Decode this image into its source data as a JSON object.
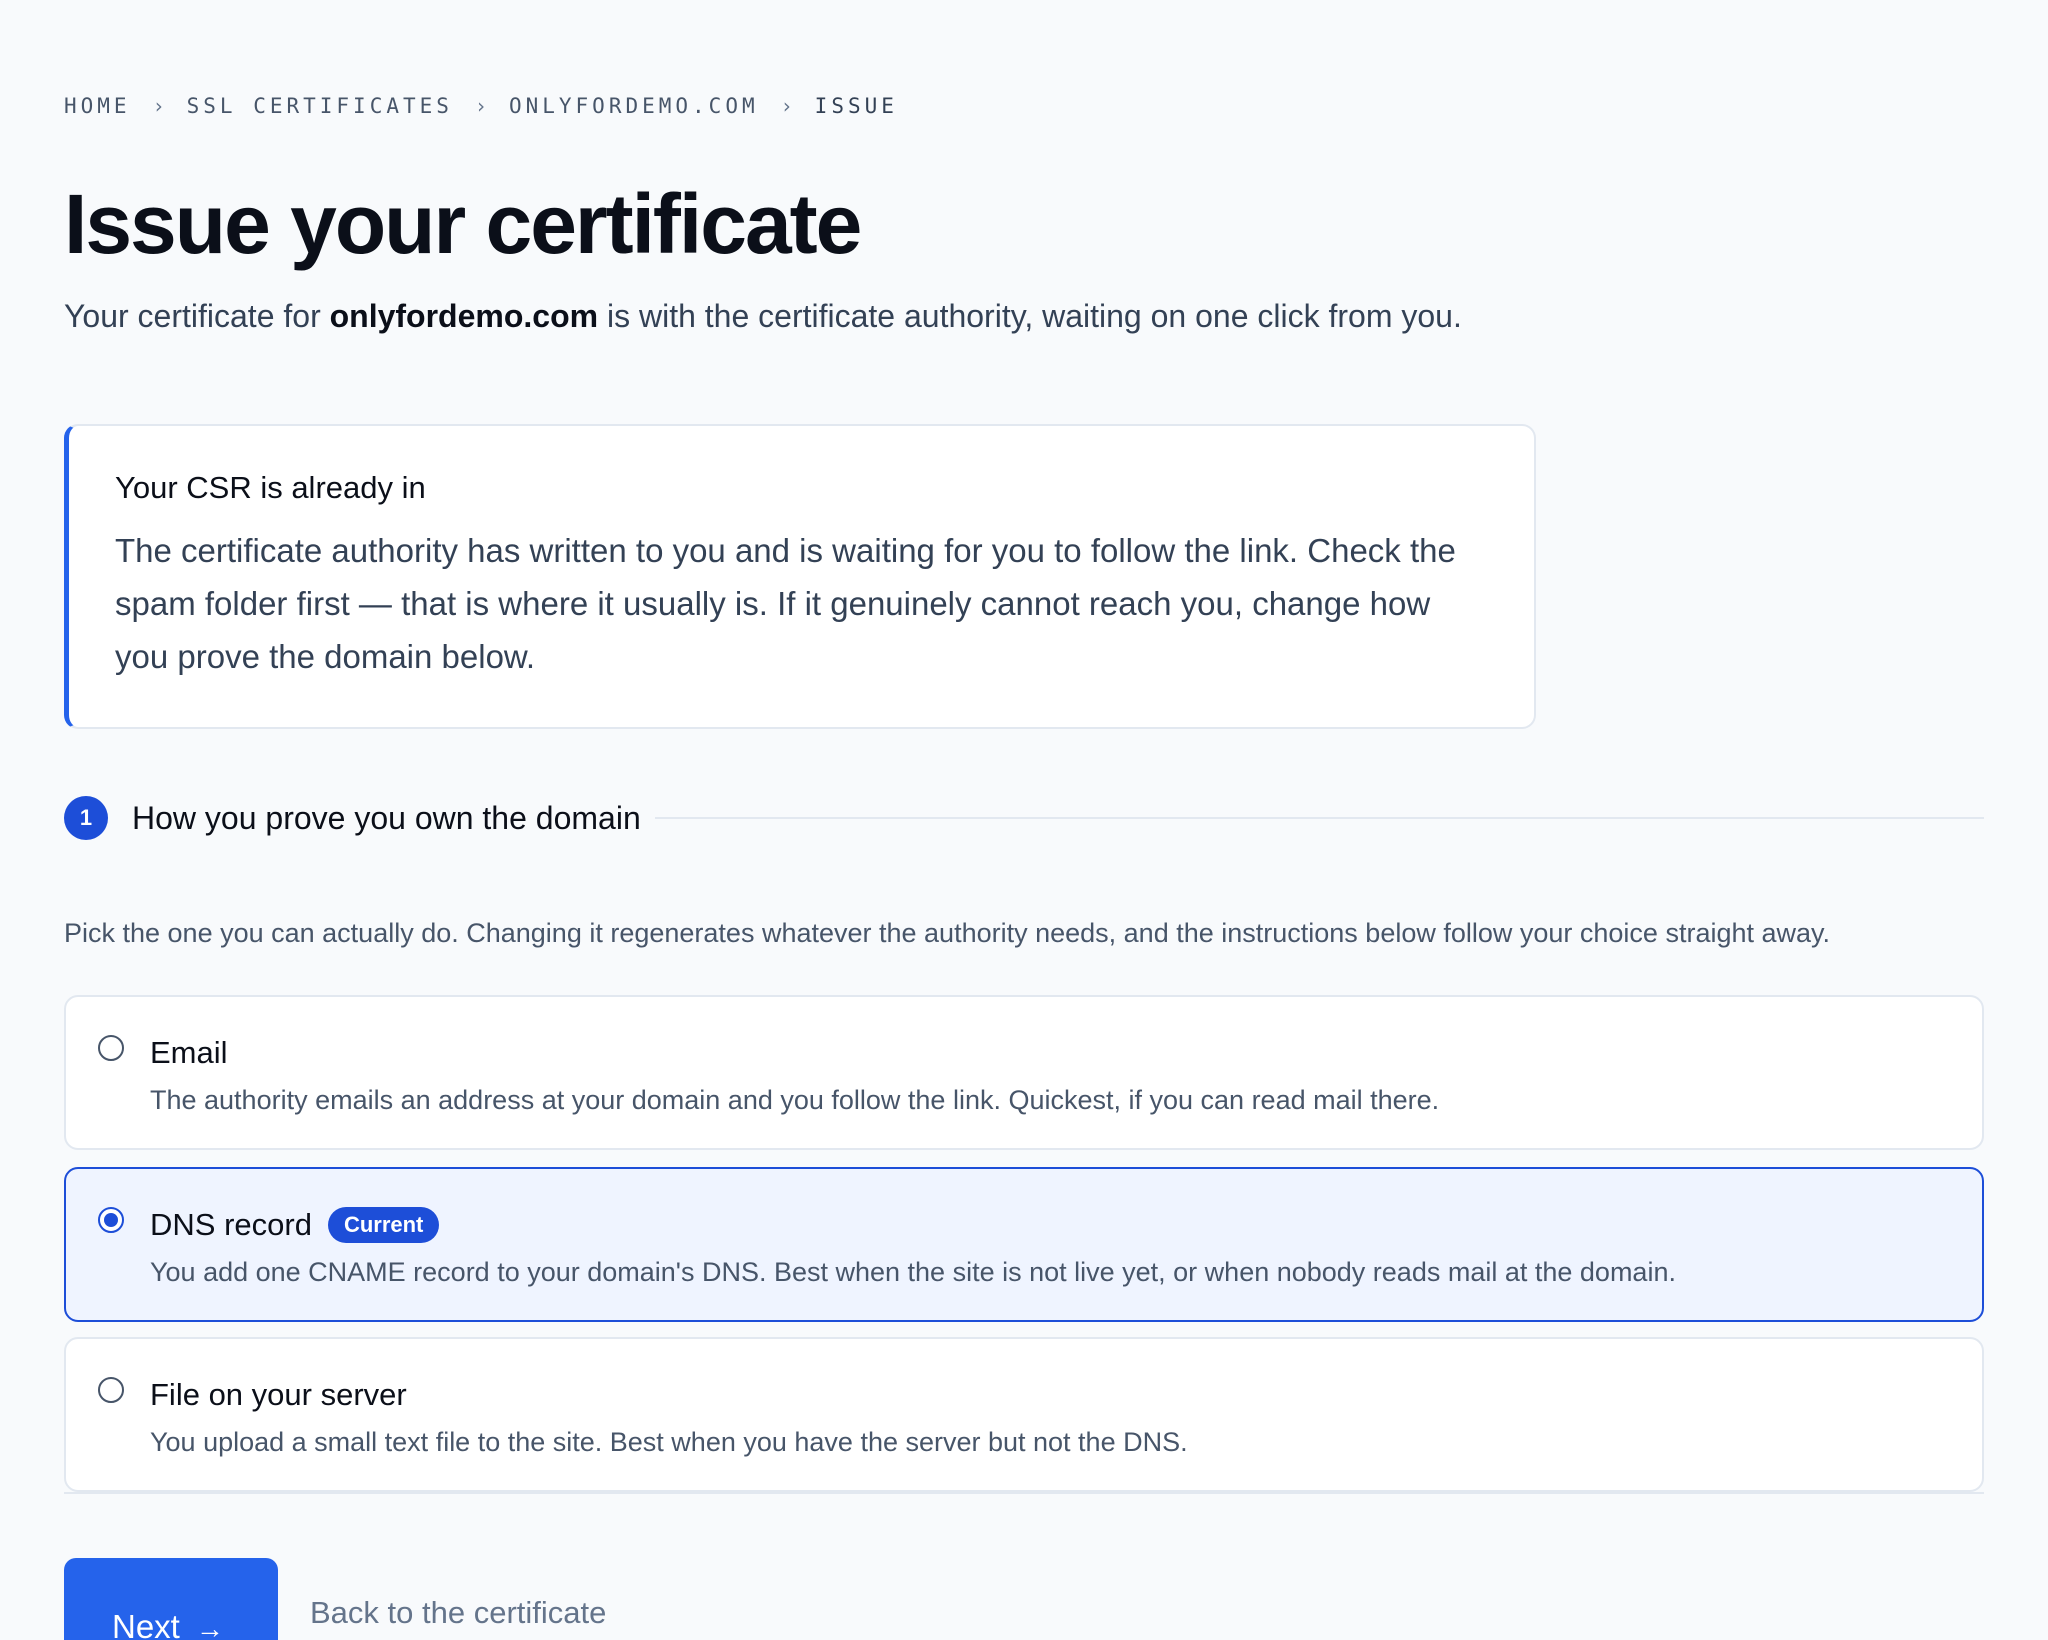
{
  "breadcrumb": {
    "items": [
      "HOME",
      "SSL CERTIFICATES",
      "ONLYFORDEMO.COM",
      "ISSUE"
    ],
    "separator": "›"
  },
  "header": {
    "title": "Issue your certificate",
    "subtitle_prefix": "Your certificate for ",
    "subtitle_domain": "onlyfordemo.com",
    "subtitle_suffix": " is with the certificate authority, waiting on one click from you."
  },
  "callout": {
    "title": "Your CSR is already in",
    "body": "The certificate authority has written to you and is waiting for you to follow the link. Check the spam folder first — that is where it usually is. If it genuinely cannot reach you, change how you prove the domain below.",
    "accent_color": "#2563eb"
  },
  "step": {
    "number": "1",
    "title": "How you prove you own the domain",
    "description": "Pick the one you can actually do. Changing it regenerates whatever the authority needs, and the instructions below follow your choice straight away."
  },
  "options": [
    {
      "title": "Email",
      "description": "The authority emails an address at your domain and you follow the link. Quickest, if you can read mail there.",
      "selected": false
    },
    {
      "title": "DNS record",
      "badge": "Current",
      "description": "You add one CNAME record to your domain's DNS. Best when the site is not live yet, or when nobody reads mail at the domain.",
      "selected": true
    },
    {
      "title": "File on your server",
      "description": "You upload a small text file to the site. Best when you have the server but not the DNS.",
      "selected": false
    }
  ],
  "actions": {
    "next_label": "Next",
    "next_icon": "arrow-right-icon",
    "back_label": "Back to the certificate"
  },
  "colors": {
    "primary": "#2563eb",
    "selected_border": "#1d4ed8",
    "selected_bg": "#eff4ff"
  }
}
